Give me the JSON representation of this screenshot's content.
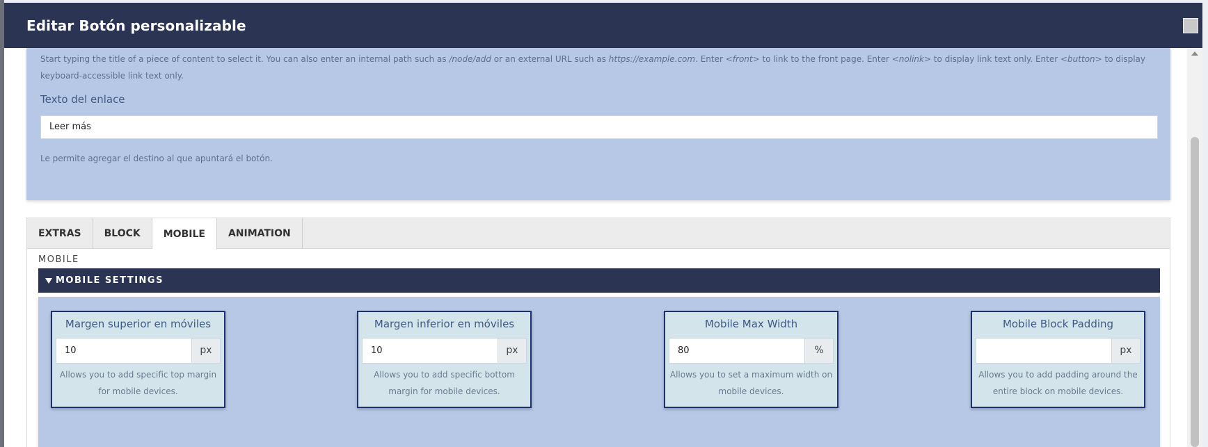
{
  "dialog": {
    "title": "Editar Botón personalizable"
  },
  "link_help": {
    "part1": "Start typing the title of a piece of content to select it. You can also enter an internal path such as ",
    "path_example": "/node/add",
    "part2": " or an external URL such as ",
    "url_example": "https://example.com",
    "part3": ". Enter ",
    "front": "<front>",
    "part4": " to link to the front page. Enter ",
    "nolink": "<nolink>",
    "part5": " to display link text only. Enter ",
    "button": "<button>",
    "part6": " to display keyboard-accessible link text only."
  },
  "link_text_field": {
    "label": "Texto del enlace",
    "value": "Leer más",
    "description": "Le permite agregar el destino al que apuntará el botón."
  },
  "tabs": [
    {
      "label": "EXTRAS",
      "active": false
    },
    {
      "label": "BLOCK",
      "active": false
    },
    {
      "label": "MOBILE",
      "active": true
    },
    {
      "label": "ANIMATION",
      "active": false
    }
  ],
  "mobile_section": {
    "caption": "MOBILE",
    "settings_header": "MOBILE SETTINGS",
    "fields": [
      {
        "title": "Margen superior en móviles",
        "value": "10",
        "unit": "px",
        "description": "Allows you to add specific top margin for mobile devices."
      },
      {
        "title": "Margen inferior en móviles",
        "value": "10",
        "unit": "px",
        "description": "Allows you to add specific bottom margin for mobile devices."
      },
      {
        "title": "Mobile Max Width",
        "value": "80",
        "unit": "%",
        "description": "Allows you to set a maximum width on mobile devices."
      },
      {
        "title": "Mobile Block Padding",
        "value": "",
        "unit": "px",
        "description": "Allows you to add padding around the entire block on mobile devices."
      }
    ]
  },
  "colors": {
    "header_bg": "#2b3553",
    "panel_bg": "#b7c8e6",
    "card_bg": "#d3e4ea",
    "card_border": "#1c3270"
  },
  "icons": {
    "close": "close-icon",
    "collapse": "caret-down-icon",
    "scroll_up": "scroll-up-arrow-icon"
  }
}
